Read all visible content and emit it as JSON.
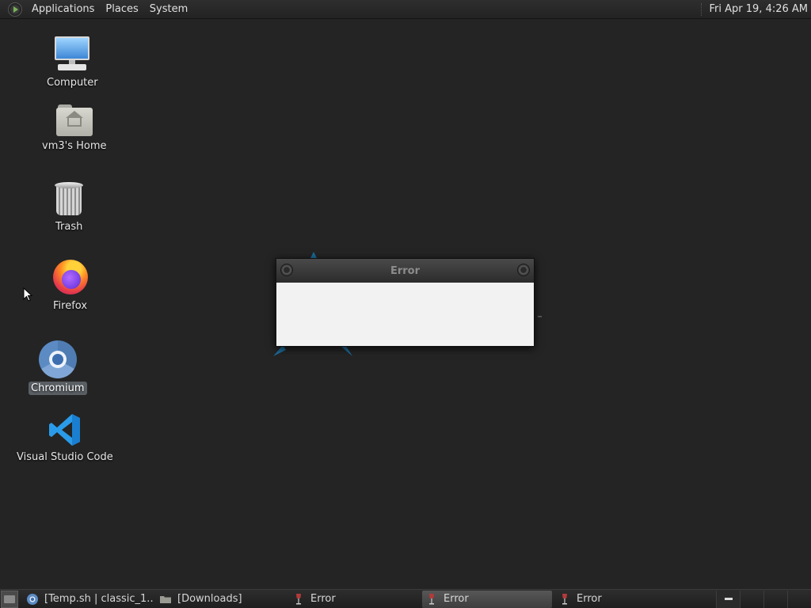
{
  "top_panel": {
    "menus": [
      "Applications",
      "Places",
      "System"
    ],
    "clock": "Fri Apr 19,  4:26 AM"
  },
  "desktop": {
    "icons": [
      {
        "label": "Computer",
        "icon": "computer-icon"
      },
      {
        "label": "vm3's Home",
        "icon": "home-folder-icon"
      },
      {
        "label": "Trash",
        "icon": "trash-icon"
      },
      {
        "label": "Firefox",
        "icon": "firefox-icon"
      },
      {
        "label": "Chromium",
        "icon": "chromium-icon",
        "selected": true
      },
      {
        "label": "Visual Studio Code",
        "icon": "vscode-icon"
      }
    ]
  },
  "dialog": {
    "title": "Error",
    "trademark": "™"
  },
  "taskbar": {
    "tasks": [
      {
        "label": "[Temp.sh | classic_1....",
        "icon": "chromium-icon",
        "active": false
      },
      {
        "label": "[Downloads]",
        "icon": "folder-icon",
        "active": false
      },
      {
        "label": "Error",
        "icon": "wine-icon",
        "active": false
      },
      {
        "label": "Error",
        "icon": "wine-icon",
        "active": true
      },
      {
        "label": "Error",
        "icon": "wine-icon",
        "active": false
      }
    ],
    "workspace_count": 4
  },
  "colors": {
    "desktop_bg": "#242424",
    "panel_bg": "#2a2a2a",
    "dialog_bg": "#f2f2f2",
    "star_accent": "#1c6b9a"
  }
}
